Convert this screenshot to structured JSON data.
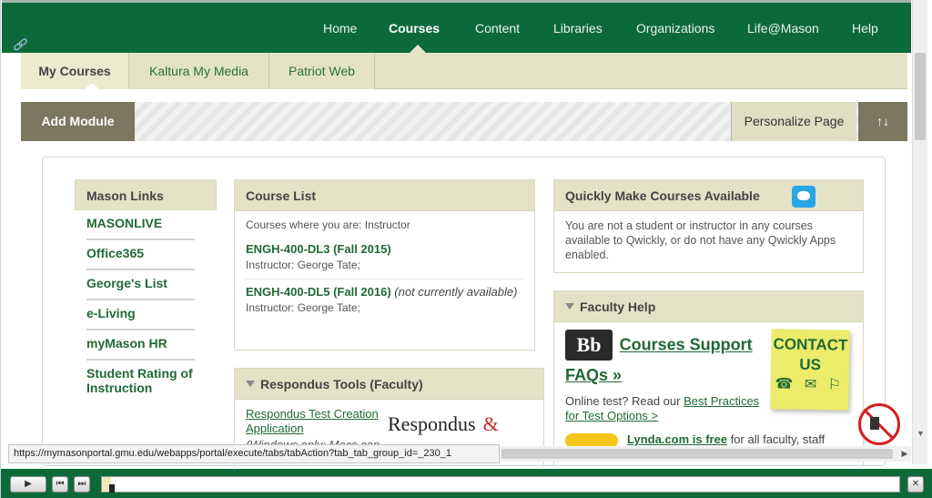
{
  "nav": {
    "items": [
      "Home",
      "Courses",
      "Content",
      "Libraries",
      "Organizations",
      "Life@Mason",
      "Help"
    ],
    "active": "Courses"
  },
  "subtabs": {
    "items": [
      "My Courses",
      "Kaltura My Media",
      "Patriot Web"
    ],
    "active": "My Courses"
  },
  "toolbar": {
    "add_module": "Add Module",
    "personalize": "Personalize Page",
    "sort_icon": "↑↓"
  },
  "mason_links": {
    "title": "Mason Links",
    "items": [
      "MASONLIVE",
      "Office365",
      "George's List",
      "e-Living",
      "myMason HR",
      "Student Rating of Instruction"
    ]
  },
  "course_list": {
    "title": "Course List",
    "intro": "Courses where you are: Instructor",
    "courses": [
      {
        "name": "ENGH-400-DL3 (Fall 2015)",
        "note": "",
        "instructor_label": "Instructor:",
        "instructor": "George Tate;"
      },
      {
        "name": "ENGH-400-DL5 (Fall 2016)",
        "note": "(not currently available)",
        "instructor_label": "Instructor:",
        "instructor": "George Tate;"
      }
    ]
  },
  "respondus": {
    "title": "Respondus Tools (Faculty)",
    "link": "Respondus Test Creation Application",
    "note": "(Windows only: Macs can",
    "logo_text": "Respondus",
    "logo_amp": "&"
  },
  "qwickly": {
    "title": "Quickly Make Courses Available",
    "text": "You are not a student or instructor in any courses available to Qwickly, or do not have any Qwickly Apps enabled."
  },
  "faculty_help": {
    "title": "Faculty Help",
    "bb_logo": "Bb",
    "courses_support": "Courses Support",
    "faqs": "FAQs »",
    "contact_line1": "CONTACT",
    "contact_line2": "US",
    "contact_icons": "☎ ✉ ⚐",
    "test_prefix": "Online test? Read our",
    "test_link": "Best Practices for Test Options >",
    "lynda_bold": "Lynda.com is free",
    "lynda_rest": "for all faculty, staff"
  },
  "statusbar": {
    "url": "https://mymasonportal.gmu.edu/webapps/portal/execute/tabs/tabAction?tab_tab_group_id=_230_1"
  },
  "player": {
    "play": "▶",
    "prev": "⏮",
    "next": "⏭",
    "close": "✕",
    "progress": 0.004
  },
  "colors": {
    "brand_green": "#0c6a3a",
    "tab_tan": "#e3e2c6",
    "link_green": "#1f6a35",
    "toolbar_dark": "#7b7760"
  }
}
